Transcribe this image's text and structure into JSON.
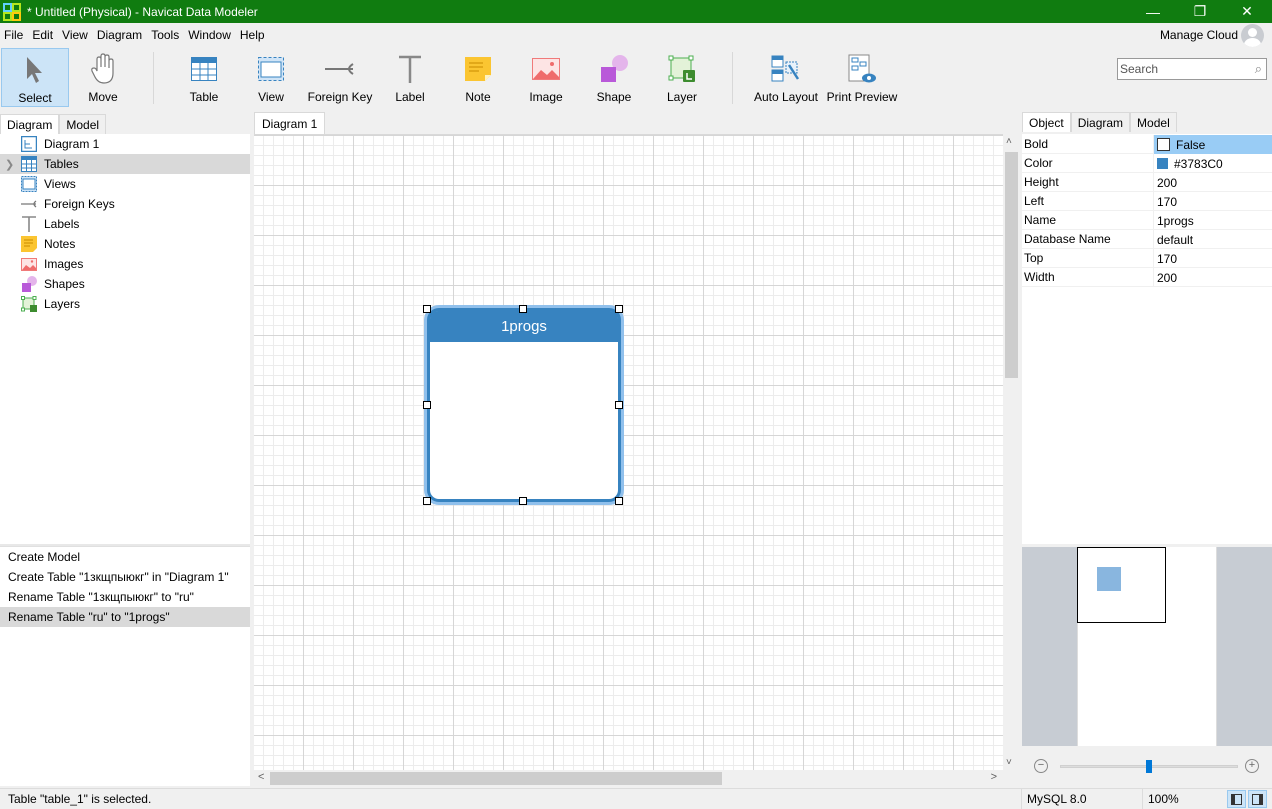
{
  "window": {
    "title": "* Untitled (Physical) - Navicat Data Modeler",
    "minimize": "—",
    "maximize": "❐",
    "close": "✕"
  },
  "menu": [
    "File",
    "Edit",
    "View",
    "Diagram",
    "Tools",
    "Window",
    "Help"
  ],
  "account": {
    "manage_cloud": "Manage Cloud"
  },
  "search": {
    "placeholder": "Search",
    "icon": "search-icon"
  },
  "toolbar": {
    "select": "Select",
    "move": "Move",
    "table": "Table",
    "view": "View",
    "foreign_key": "Foreign Key",
    "label": "Label",
    "note": "Note",
    "image": "Image",
    "shape": "Shape",
    "layer": "Layer",
    "auto_layout": "Auto Layout",
    "print_preview": "Print Preview",
    "active_tool": "Select"
  },
  "left_panel": {
    "tabs": [
      "Diagram",
      "Model"
    ],
    "active_tab": "Diagram",
    "tree": [
      {
        "label": "Diagram 1",
        "icon": "diagram-icon"
      },
      {
        "label": "Tables",
        "icon": "table-icon",
        "selected": true,
        "expandable": true
      },
      {
        "label": "Views",
        "icon": "view-icon"
      },
      {
        "label": "Foreign Keys",
        "icon": "foreign-key-icon"
      },
      {
        "label": "Labels",
        "icon": "label-icon"
      },
      {
        "label": "Notes",
        "icon": "note-icon"
      },
      {
        "label": "Images",
        "icon": "image-icon"
      },
      {
        "label": "Shapes",
        "icon": "shape-icon"
      },
      {
        "label": "Layers",
        "icon": "layer-icon"
      }
    ]
  },
  "history": [
    "Create Model",
    "Create Table \"1зкщпыюкг\" in \"Diagram 1\"",
    "Rename Table \"1зкщпыюкг\" to \"ru\"",
    "Rename Table \"ru\" to \"1progs\""
  ],
  "canvas": {
    "tab": "Diagram 1",
    "table": {
      "name": "1progs",
      "color": "#3783C0"
    }
  },
  "properties": {
    "tabs": [
      "Object",
      "Diagram",
      "Model"
    ],
    "active_tab": "Object",
    "rows": [
      {
        "key": "Bold",
        "value": "False"
      },
      {
        "key": "Color",
        "value": "#3783C0"
      },
      {
        "key": "Height",
        "value": "200"
      },
      {
        "key": "Left",
        "value": "170"
      },
      {
        "key": "Name",
        "value": "1progs"
      },
      {
        "key": "Database Name",
        "value": "default"
      },
      {
        "key": "Top",
        "value": "170"
      },
      {
        "key": "Width",
        "value": "200"
      }
    ]
  },
  "zoom": {
    "minus": "−",
    "plus": "+",
    "level_percent": 50
  },
  "status": {
    "message": "Table \"table_1\" is selected.",
    "database": "MySQL 8.0",
    "zoom": "100%"
  },
  "scroll": {
    "left": "<",
    "right": ">",
    "up": "^",
    "down": "v"
  }
}
